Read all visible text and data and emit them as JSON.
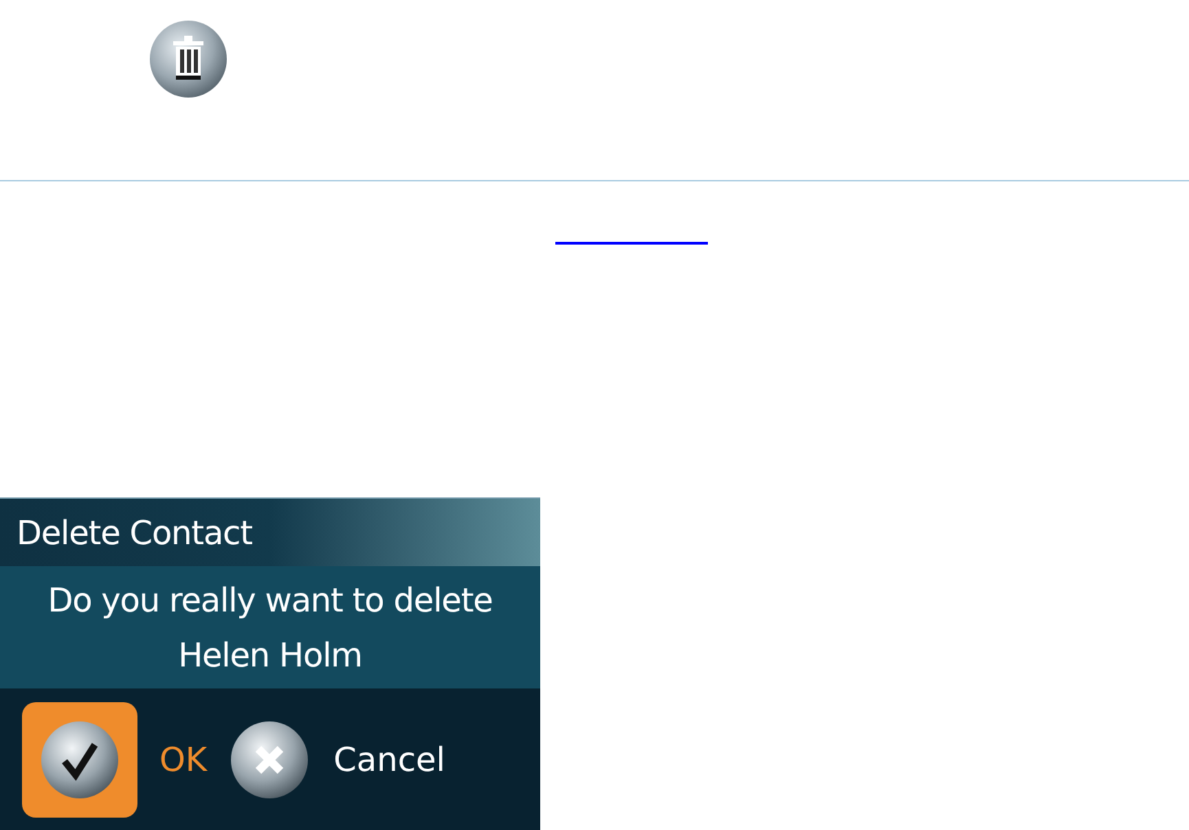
{
  "dialog": {
    "title": "Delete Contact",
    "message": [
      "Do you really want to delete",
      "Helen Holm"
    ],
    "buttons": [
      {
        "kind": "confirm",
        "label": "OK",
        "selected": true
      },
      {
        "kind": "cancel",
        "label": "Cancel",
        "selected": false
      }
    ]
  }
}
